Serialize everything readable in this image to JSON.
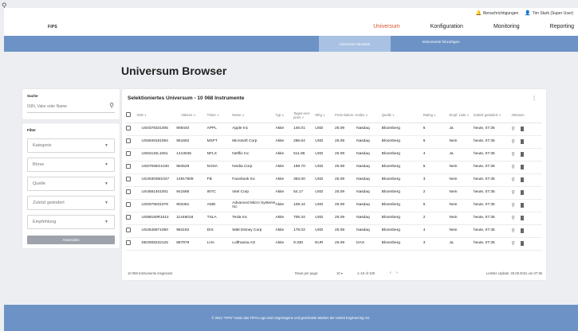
{
  "corner_icon": "search-icon",
  "utility": {
    "notifications": "Benachrichtigungen",
    "user": "Tim Stark (Super User)"
  },
  "logo": "FIPS",
  "nav": [
    {
      "label": "Universum",
      "active": true
    },
    {
      "label": "Konfiguration",
      "active": false
    },
    {
      "label": "Monitoring",
      "active": false
    },
    {
      "label": "Reporting",
      "active": false
    }
  ],
  "subnav": {
    "tab1": "Universum Browser",
    "tab2": "Instrumente hinzufügen"
  },
  "page_title": "Universum Browser",
  "search": {
    "label": "Suche",
    "placeholder": "ISIN, Valor oder Name"
  },
  "filter": {
    "label": "Filter",
    "selects": [
      "Kategorie",
      "Börse",
      "Quelle",
      "Zuletzt geändert",
      "Empfehlung"
    ],
    "apply": "Anwenden"
  },
  "table": {
    "title": "Selektioniertes Universum - 10 068 Instrumente",
    "headers": [
      "ISIN",
      "Valoren",
      "Ticker",
      "Name",
      "Typ",
      "Tages-end-preis",
      "Whg",
      "Preis Datum",
      "Index",
      "Quelle",
      "Rating",
      "Empf. Liste",
      "Zuletzt geändert",
      "Aktionen"
    ],
    "rows": [
      [
        "US0378331005",
        "908440",
        "APPL",
        "Apple Inc",
        "Aktie",
        "146.01",
        "USD",
        "25.09",
        "Nasdaq",
        "Bloomberg",
        "6",
        "Ja",
        "heute, 07:35"
      ],
      [
        "US5949181094",
        "951692",
        "MSFT",
        "Microsoft Corp",
        "Aktie",
        "286.64",
        "USD",
        "25.09",
        "Nasdaq",
        "Bloomberg",
        "6",
        "Nein",
        "heute, 07:35"
      ],
      [
        "US64110L1061",
        "1413046",
        "NFLX",
        "Netflix Inc",
        "Aktie",
        "511.86",
        "USD",
        "25.09",
        "Nasdaq",
        "Bloomberg",
        "4",
        "Ja",
        "heute, 07:35"
      ],
      [
        "US67066G1040",
        "994529",
        "NVDA",
        "Nvidia Corp",
        "Aktie",
        "198.70",
        "USD",
        "25.09",
        "Nasdaq",
        "Bloomberg",
        "5",
        "Nein",
        "heute, 07:35"
      ],
      [
        "US30303M1027",
        "14917609",
        "FB",
        "Facebook Inc",
        "Aktie",
        "363.00",
        "USD",
        "25.09",
        "Nasdaq",
        "Bloomberg",
        "3",
        "Nein",
        "heute, 07:35"
      ],
      [
        "US4581401001",
        "941595",
        "INTC",
        "Intel Corp",
        "Aktie",
        "54.17",
        "USD",
        "25.09",
        "Nasdaq",
        "Bloomberg",
        "2",
        "Nein",
        "heute, 07:35"
      ],
      [
        "US0079031078",
        "903491",
        "AMD",
        "Advanced Micro Systems Inc",
        "Aktie",
        "108.44",
        "USD",
        "25.09",
        "Nasdaq",
        "Bloomberg",
        "5",
        "Nein",
        "heute, 07:35"
      ],
      [
        "US88160R1014",
        "11448018",
        "TSLA",
        "Tesla Inc",
        "Aktie",
        "706.34",
        "USD",
        "25.09",
        "Nasdaq",
        "Bloomberg",
        "2",
        "Nein",
        "heute, 07:35"
      ],
      [
        "US2546871060",
        "984192",
        "DIS",
        "Walt Disney Corp",
        "Aktie",
        "178.02",
        "USD",
        "25.09",
        "Nasdaq",
        "Bloomberg",
        "4",
        "Nein",
        "heute, 07:35"
      ],
      [
        "DE0008232125",
        "887979",
        "LHA",
        "Lufthansa AG",
        "Aktie",
        "9.330",
        "EUR",
        "25.09",
        "DAX",
        "Bloomberg",
        "3",
        "Ja",
        "heute, 07:35"
      ]
    ],
    "footer": {
      "total": "10 068 Instrumente insgesamt",
      "rows_per_page": "Rows per page:",
      "rows_per_page_value": "10",
      "range": "1–10 of 100",
      "updated": "Letztes Update: 25.09.2021 um 07:35"
    }
  },
  "footer": "© 2021 \"FIPS\" sowie das FIPS-Logo sind eingetragene und geschützte Marken der Unitek Engineering AG."
}
